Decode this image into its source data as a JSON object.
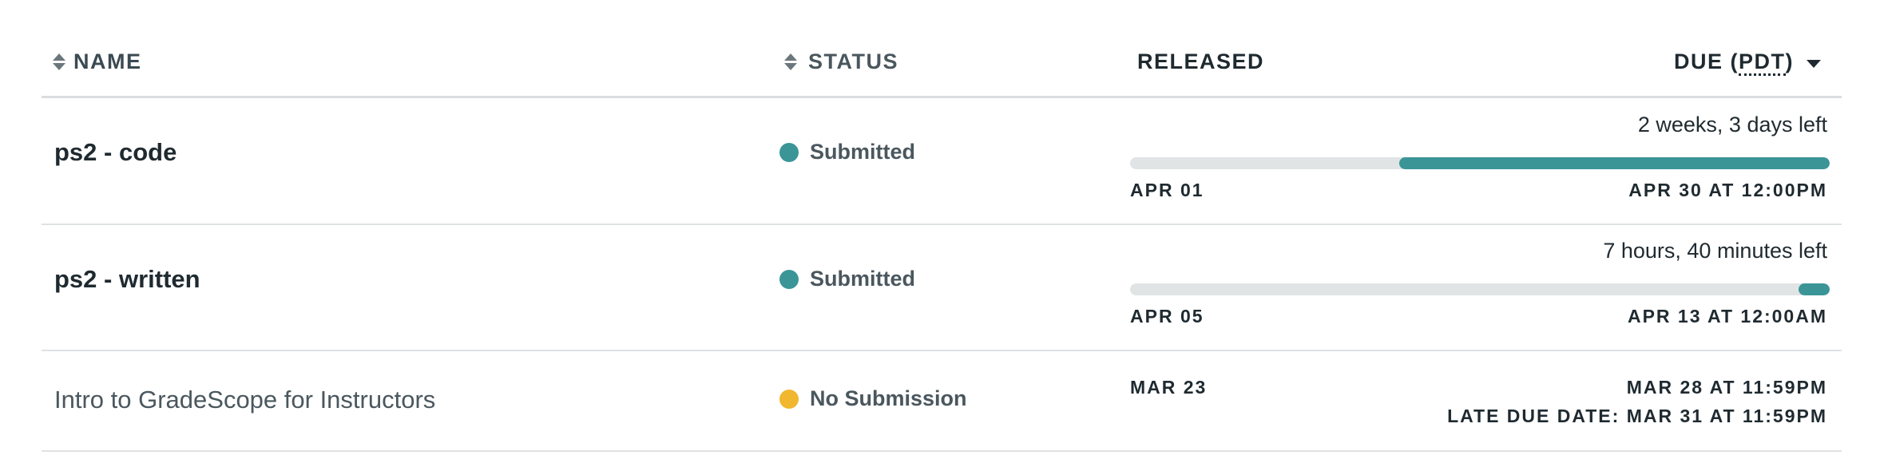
{
  "header": {
    "name": "NAME",
    "status": "STATUS",
    "released": "RELEASED",
    "due_prefix": "DUE (",
    "due_tz": "PDT",
    "due_suffix": ")"
  },
  "colors": {
    "submitted": "#3b9597",
    "no_submission": "#f0b72f",
    "progress_fill": "#3b9597",
    "progress_track": "#e1e4e5"
  },
  "rows": [
    {
      "name": "ps2 - code",
      "status": "Submitted",
      "time_left": "2 weeks, 3 days left",
      "released": "APR 01",
      "due": "APR 30 AT 12:00PM",
      "progress_remaining": 0.615
    },
    {
      "name": "ps2 - written",
      "status": "Submitted",
      "time_left": "7 hours, 40 minutes left",
      "released": "APR 05",
      "due": "APR 13 AT 12:00AM",
      "progress_remaining": 0.045
    },
    {
      "name": "Intro to GradeScope for Instructors",
      "status": "No Submission",
      "released": "MAR 23",
      "due": "MAR 28 AT 11:59PM",
      "late_due": "LATE DUE DATE: MAR 31 AT 11:59PM"
    }
  ]
}
